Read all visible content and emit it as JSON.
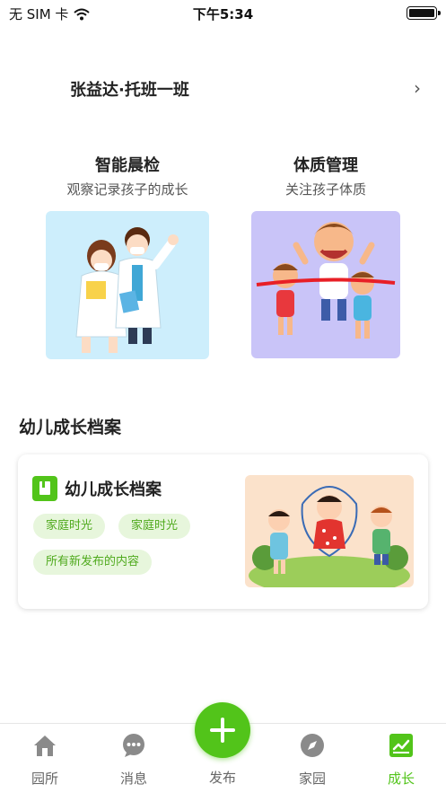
{
  "status_bar": {
    "carrier": "无 SIM 卡",
    "time": "下午5:34"
  },
  "class_row": {
    "name": "张益达·托班一班"
  },
  "features": [
    {
      "title": "智能晨检",
      "subtitle": "观察记录孩子的成长"
    },
    {
      "title": "体质管理",
      "subtitle": "关注孩子体质"
    }
  ],
  "section": {
    "title": "幼儿成长档案"
  },
  "card": {
    "title": "幼儿成长档案",
    "tags": [
      "家庭时光",
      "家庭时光",
      "所有新发布的内容"
    ]
  },
  "tab_bar": {
    "items": [
      "园所",
      "消息",
      "发布",
      "家园",
      "成长"
    ],
    "active": "成长"
  },
  "colors": {
    "accent": "#52c41a",
    "tag_bg": "#e7f6dc"
  }
}
